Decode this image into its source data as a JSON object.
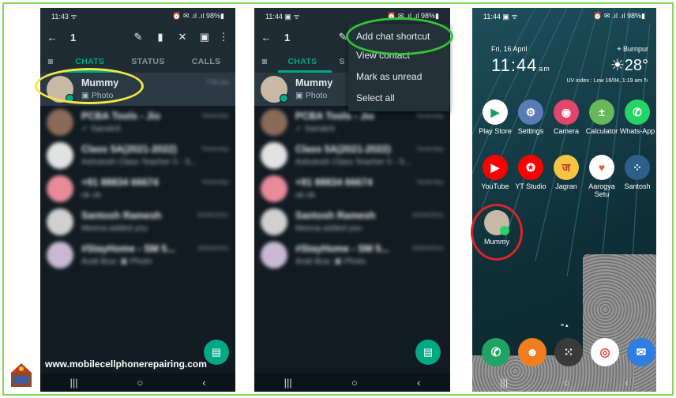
{
  "panel1": {
    "status": {
      "time": "11:43 ᯤ",
      "right": "⏰ ✉ .ıl .ıl 98%▮"
    },
    "appbar": {
      "count": "1"
    },
    "tabs": {
      "chats": "CHATS",
      "status": "STATUS",
      "calls": "CALLS"
    },
    "chats": [
      {
        "name": "Mummy",
        "sub": "▣ Photo",
        "time": "7:05 am",
        "color": "#c8b8a6"
      },
      {
        "name": "PCBA Tools - Jio",
        "sub": "✓ Sanskrit",
        "time": "Yesterday",
        "color": "#8a6a58"
      },
      {
        "name": "Class 5A(2021-2022)",
        "sub": "Ashutosh Class Teacher 5 - S...",
        "time": "Yesterday",
        "color": "#e2e2e2"
      },
      {
        "name": "+91 88834 66674",
        "sub": "ok ok",
        "time": "Yesterday",
        "color": "#e88a9a"
      },
      {
        "name": "Santosh Ramesh",
        "sub": "Meena added you",
        "time": "05/04/2021",
        "color": "#d0d0d0"
      },
      {
        "name": "#StayHome - SM 5...",
        "sub": "Arati Bua: ▣ Photo",
        "time": "26/03/2021",
        "color": "#c8b8d4"
      }
    ],
    "watermark": "www.mobilecellphonerepairing.com"
  },
  "panel2": {
    "status": {
      "time": "11:44 ▣ ᯤ",
      "right": "⏰ ✉ .ıl .ıl 98%▮"
    },
    "appbar": {
      "count": "1"
    },
    "tabs": {
      "chats": "CHATS",
      "status": "S"
    },
    "menu": [
      "Add chat shortcut",
      "View contact",
      "Mark as unread",
      "Select all"
    ],
    "chats": [
      {
        "name": "Mummy",
        "sub": "▣ Photo",
        "time": "",
        "color": "#c8b8a6"
      },
      {
        "name": "PCBA Tools - Jio",
        "sub": "✓ Sanskrit",
        "time": "Yesterday",
        "color": "#8a6a58"
      },
      {
        "name": "Class 5A(2021-2022)",
        "sub": "Ashutosh Class Teacher 5 - S...",
        "time": "Yesterday",
        "color": "#e2e2e2"
      },
      {
        "name": "+91 88834 66674",
        "sub": "ok ok",
        "time": "Yesterday",
        "color": "#e88a9a"
      },
      {
        "name": "Santosh Ramesh",
        "sub": "Meena added you",
        "time": "05/04/2021",
        "color": "#d0d0d0"
      },
      {
        "name": "#StayHome - SM 5...",
        "sub": "Arati Bua: ▣ Photo",
        "time": "26/03/2021",
        "color": "#c8b8d4"
      }
    ]
  },
  "panel3": {
    "status": {
      "time": "11:44 ▣ ᯤ",
      "right": "⏰ ✉ .ıl .ıl 98%▮"
    },
    "date": "Fri, 16 April",
    "clock": "11:44",
    "ampm": "am",
    "location": "⌖ Burnpur",
    "temperature": "☀28°",
    "uv": "UV index : Low   16/04, 1:19 am ↻",
    "apps_row1": [
      {
        "label": "Play Store",
        "glyph": "▶",
        "color": "#ffffff",
        "fg": "#1a9e5f"
      },
      {
        "label": "Settings",
        "glyph": "⚙",
        "color": "#5b7bb7",
        "fg": "#ffffff"
      },
      {
        "label": "Camera",
        "glyph": "◉",
        "color": "#e4456a",
        "fg": "#ffffff"
      },
      {
        "label": "Calculator",
        "glyph": "±",
        "color": "#67b85a",
        "fg": "#ffffff"
      },
      {
        "label": "Whats-App",
        "glyph": "✆",
        "color": "#25d366",
        "fg": "#ffffff"
      }
    ],
    "apps_row2": [
      {
        "label": "YouTube",
        "glyph": "▶",
        "color": "#ff0000",
        "fg": "#ffffff"
      },
      {
        "label": "YT Studio",
        "glyph": "✪",
        "color": "#ff0000",
        "fg": "#ffffff"
      },
      {
        "label": "Jagran",
        "glyph": "ज",
        "color": "#f5c542",
        "fg": "#c0392b"
      },
      {
        "label": "Aarogya Setu",
        "glyph": "♥",
        "color": "#ffffff",
        "fg": "#e65c3b"
      },
      {
        "label": "Santosh",
        "glyph": "⁘",
        "color": "#2d5f8a",
        "fg": "#ffffff"
      }
    ],
    "shortcut": {
      "label": "Mummy"
    },
    "dock": [
      {
        "glyph": "✆",
        "color": "#1fa463"
      },
      {
        "glyph": "☻",
        "color": "#f07e20"
      },
      {
        "glyph": "⁙",
        "color": "#3a3a3a"
      },
      {
        "glyph": "◎",
        "color": "#ffffff"
      },
      {
        "glyph": "✉",
        "color": "#2f7de1"
      }
    ]
  },
  "nav": {
    "recent": "|||",
    "home": "○",
    "back": "‹"
  },
  "accent": {
    "green": "#00a884",
    "highlight_yellow": "#f5e642",
    "highlight_green": "#35c435",
    "highlight_red": "#d8262a"
  }
}
